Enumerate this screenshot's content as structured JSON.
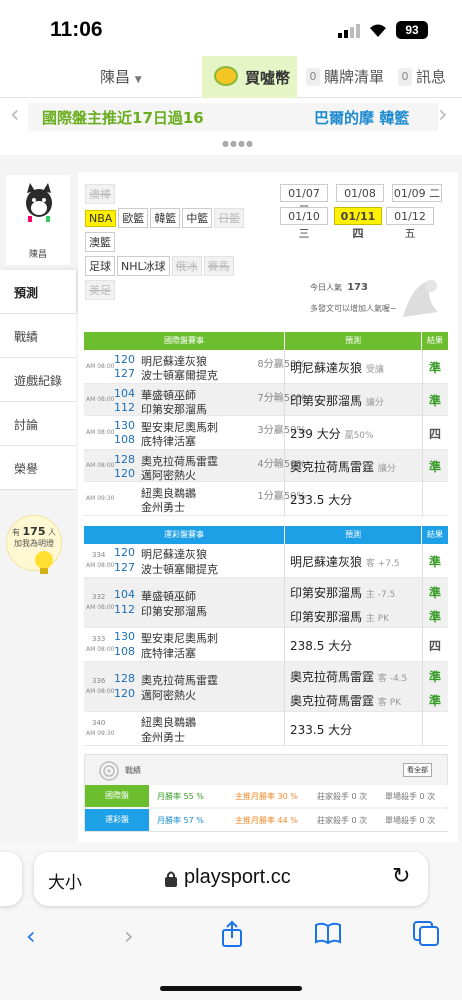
{
  "status_bar": {
    "time": "11:06",
    "battery": "93"
  },
  "top_nav": {
    "user": "陳昌",
    "coins": "買噓幣",
    "bought_count": "0",
    "bought_label": "購牌清單",
    "msg_count": "0",
    "msg_label": "訊息"
  },
  "ticker": {
    "left": "國際盤主推近17日過16",
    "right": "巴爾的摩 韓籃"
  },
  "sidebar": {
    "username": "陳昌",
    "items": [
      "預測",
      "戰績",
      "遊戲紀錄",
      "討論",
      "榮譽"
    ],
    "fans_prefix": "有",
    "fans_count": "175",
    "fans_unit": "人",
    "fans_text": "加我為明燈"
  },
  "sports": {
    "row1": [
      "澳棒"
    ],
    "row2": [
      "NBA",
      "歐籃",
      "韓籃",
      "中籃",
      "日籃"
    ],
    "row3": [
      "澳籃"
    ],
    "row4": [
      "足球",
      "NHL冰球",
      "俄冰",
      "賽馬",
      "美足"
    ]
  },
  "dates": [
    "01/07 日",
    "01/08 一",
    "01/09 二",
    "01/10 三",
    "01/11 四",
    "01/12 五"
  ],
  "popularity": {
    "label": "今日人氣",
    "value": "173",
    "note": "多發文可以增加人氣喔~"
  },
  "intl_table": {
    "head_game": "國際盤賽事",
    "head_pred": "預測",
    "head_res": "結果",
    "rows": [
      {
        "time": "AM 08:00",
        "n1": "120",
        "t1": "明尼蘇達灰狼",
        "n2": "127",
        "t2": "波士頓塞爾提克",
        "odds": "8分贏50%",
        "pred": "明尼蘇達灰狼",
        "pred_note": "受讓",
        "res": "準"
      },
      {
        "time": "AM 08:00",
        "n1": "104",
        "t1": "華盛頓巫師",
        "n2": "112",
        "t2": "印第安那溜馬",
        "odds": "7分輸50%",
        "pred": "印第安那溜馬",
        "pred_note": "讓分",
        "res": "準"
      },
      {
        "time": "AM 08:00",
        "n1": "130",
        "t1": "聖安東尼奧馬刺",
        "n2": "108",
        "t2": "底特律活塞",
        "odds": "3分贏50%",
        "pred": "239 大分",
        "pred_note": "贏50%",
        "res": "四"
      },
      {
        "time": "AM 08:00",
        "n1": "128",
        "t1": "奧克拉荷馬雷霆",
        "n2": "120",
        "t2": "邁阿密熱火",
        "odds": "4分輸50%",
        "pred": "奧克拉荷馬雷霆",
        "pred_note": "讓分",
        "res": "準"
      },
      {
        "time": "AM 09:30",
        "n1": "",
        "t1": "紐奧良鵜鶘",
        "n2": "",
        "t2": "金州勇士",
        "odds": "1分贏50%",
        "pred": "233.5 大分",
        "pred_note": "",
        "res": ""
      }
    ]
  },
  "lottery_table": {
    "head_game": "運彩盤賽事",
    "head_pred": "預測",
    "head_res": "結果",
    "rows": [
      {
        "seq": "334",
        "time": "AM 08:00",
        "n1": "120",
        "t1": "明尼蘇達灰狼",
        "n2": "127",
        "t2": "波士頓塞爾提克",
        "preds": [
          {
            "p": "明尼蘇達灰狼",
            "note": "客 +7.5",
            "res": "準"
          }
        ]
      },
      {
        "seq": "332",
        "time": "AM 08:00",
        "n1": "104",
        "t1": "華盛頓巫師",
        "n2": "112",
        "t2": "印第安那溜馬",
        "preds": [
          {
            "p": "印第安那溜馬",
            "note": "主 -7.5",
            "res": "準"
          },
          {
            "p": "印第安那溜馬",
            "note": "主 PK",
            "res": "準"
          }
        ]
      },
      {
        "seq": "333",
        "time": "AM 08:00",
        "n1": "130",
        "t1": "聖安東尼奧馬刺",
        "n2": "108",
        "t2": "底特律活塞",
        "preds": [
          {
            "p": "238.5 大分",
            "note": "",
            "res": "四"
          }
        ]
      },
      {
        "seq": "336",
        "time": "AM 08:00",
        "n1": "128",
        "t1": "奧克拉荷馬雷霆",
        "n2": "120",
        "t2": "邁阿密熱火",
        "preds": [
          {
            "p": "奧克拉荷馬雷霆",
            "note": "客 -4.5",
            "res": "準"
          },
          {
            "p": "奧克拉荷馬雷霆",
            "note": "客 PK",
            "res": "準"
          }
        ]
      },
      {
        "seq": "340",
        "time": "AM 09:30",
        "n1": "",
        "t1": "紐奧良鵜鶘",
        "n2": "",
        "t2": "金州勇士",
        "preds": [
          {
            "p": "233.5 大分",
            "note": "",
            "res": ""
          }
        ]
      }
    ]
  },
  "summary": {
    "title": "戰績",
    "all_btn": "看全部",
    "rows": [
      {
        "label": "國際盤",
        "c1": "月勝率 55 %",
        "c2": "主推月勝率 30 %",
        "c3": "莊家殺手 0 次",
        "c4": "單場殺手 0 次"
      },
      {
        "label": "運彩盤",
        "c1": "月勝率 57 %",
        "c2": "主推月勝率 44 %",
        "c3": "莊家殺手 0 次",
        "c4": "單場殺手 0 次"
      }
    ]
  },
  "browser": {
    "aa": "大小",
    "url": "playsport.cc"
  },
  "colors": {
    "green": "#6cbe2e",
    "blue": "#1ea0e6",
    "yellow": "#fff100"
  }
}
